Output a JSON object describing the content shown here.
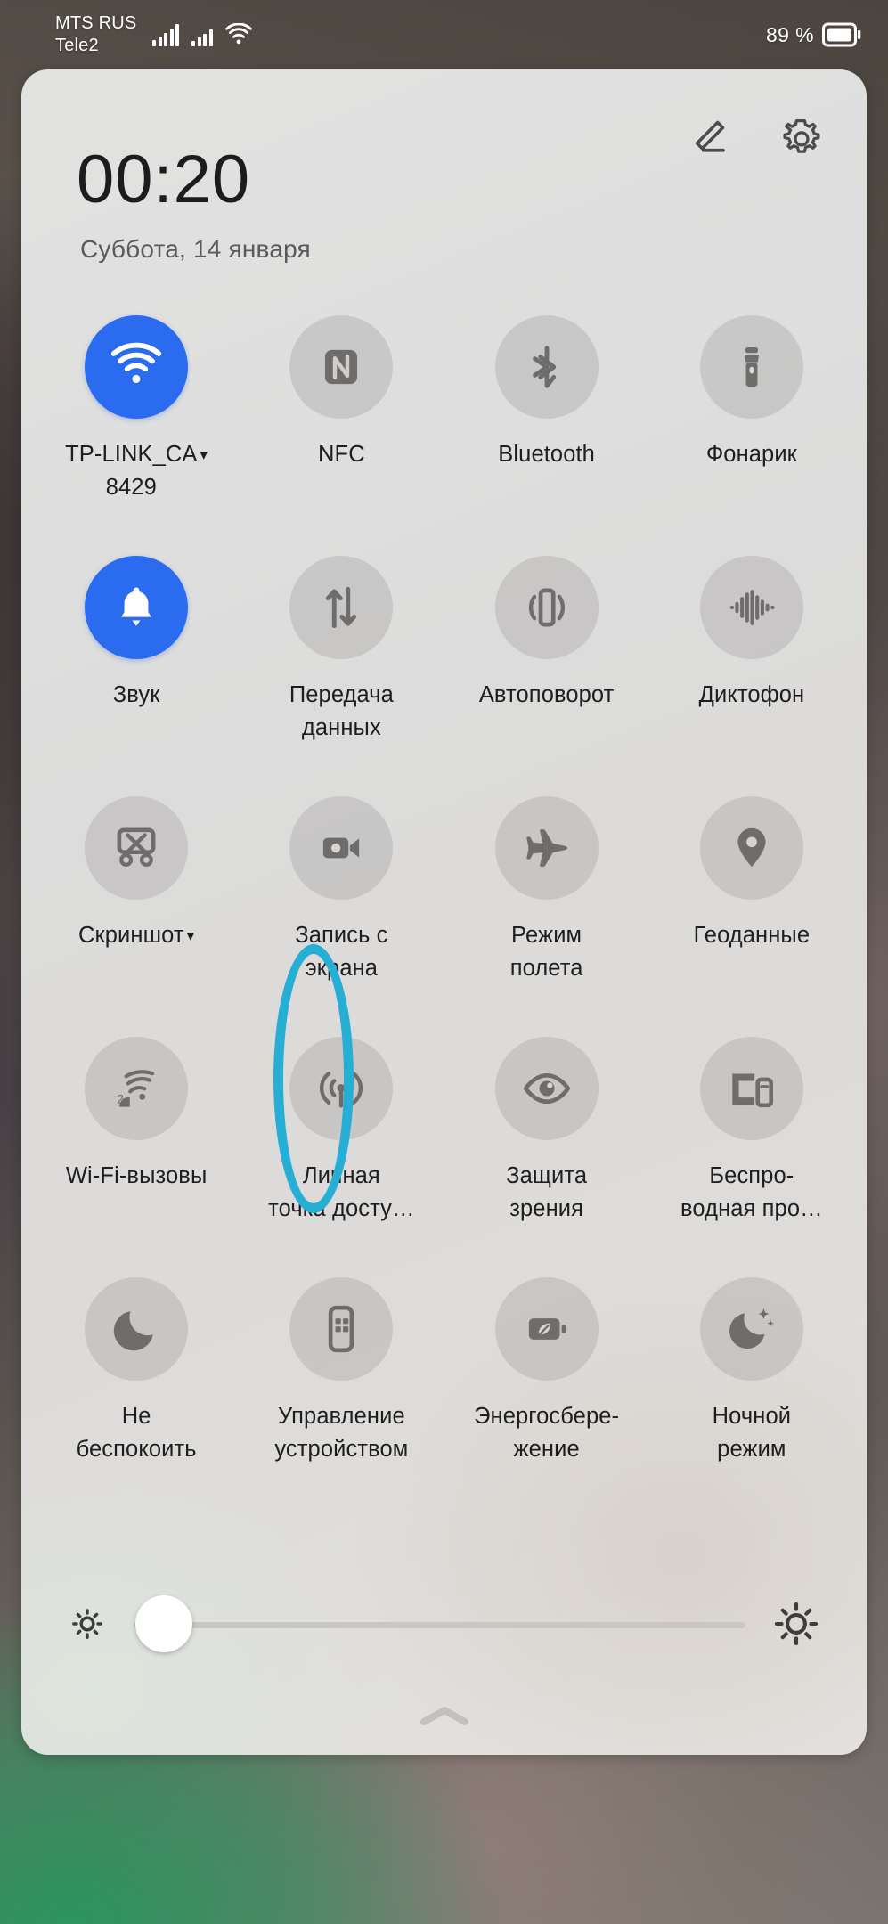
{
  "statusbar": {
    "carrier_line1": "MTS RUS",
    "carrier_line2": "Tele2",
    "signal1_icon": "signal-bars-icon",
    "signal2_icon": "signal-bars-icon",
    "wifi_icon": "wifi-icon",
    "battery_percent": "89 %",
    "battery_icon": "battery-icon"
  },
  "panel": {
    "edit_icon": "pencil-edit-icon",
    "settings_icon": "gear-settings-icon",
    "clock": "00:20",
    "date": "Суббота, 14 января",
    "handle_icon": "chevron-up-icon"
  },
  "tiles": [
    {
      "label": "TP-LINK_CA\n8429",
      "icon": "wifi-icon",
      "active": true,
      "caret": "▾"
    },
    {
      "label": "NFC",
      "icon": "nfc-icon",
      "active": false,
      "caret": ""
    },
    {
      "label": "Bluetooth",
      "icon": "bluetooth-icon",
      "active": false,
      "caret": ""
    },
    {
      "label": "Фонарик",
      "icon": "flashlight-icon",
      "active": false,
      "caret": ""
    },
    {
      "label": "Звук",
      "icon": "bell-sound-icon",
      "active": true,
      "caret": ""
    },
    {
      "label": "Передача\nданных",
      "icon": "data-transfer-icon",
      "active": false,
      "caret": ""
    },
    {
      "label": "Автоповорот",
      "icon": "auto-rotate-icon",
      "active": false,
      "caret": ""
    },
    {
      "label": "Диктофон",
      "icon": "voice-recorder-icon",
      "active": false,
      "caret": ""
    },
    {
      "label": "Скриншот",
      "icon": "screenshot-icon",
      "active": false,
      "caret": "▾"
    },
    {
      "label": "Запись с\nэкрана",
      "icon": "screen-record-icon",
      "active": false,
      "caret": ""
    },
    {
      "label": "Режим\nполета",
      "icon": "airplane-icon",
      "active": false,
      "caret": ""
    },
    {
      "label": "Геоданные",
      "icon": "location-pin-icon",
      "active": false,
      "caret": ""
    },
    {
      "label": "Wi-Fi-вызовы",
      "icon": "wifi-calling-icon",
      "active": false,
      "caret": ""
    },
    {
      "label": "Личная\nточка досту…",
      "icon": "hotspot-icon",
      "active": false,
      "caret": ""
    },
    {
      "label": "Защита\nзрения",
      "icon": "eye-comfort-icon",
      "active": false,
      "caret": ""
    },
    {
      "label": "Беспро-\nводная про…",
      "icon": "cast-projection-icon",
      "active": false,
      "caret": ""
    },
    {
      "label": "Не\nбеспокоить",
      "icon": "moon-dnd-icon",
      "active": false,
      "caret": ""
    },
    {
      "label": "Управление\nустройством",
      "icon": "remote-control-icon",
      "active": false,
      "caret": ""
    },
    {
      "label": "Энергосбере-\nжение",
      "icon": "battery-saver-icon",
      "active": false,
      "caret": ""
    },
    {
      "label": "Ночной\nрежим",
      "icon": "night-mode-icon",
      "active": false,
      "caret": ""
    }
  ],
  "brightness": {
    "low_icon": "brightness-low-icon",
    "high_icon": "brightness-high-icon",
    "value": 5
  },
  "highlight": {
    "target": "Запись с экрана",
    "color": "#27aed4"
  },
  "colors": {
    "accent_active": "#2b6bf0",
    "highlight": "#27aed4",
    "panel_bg": "#dedede"
  }
}
